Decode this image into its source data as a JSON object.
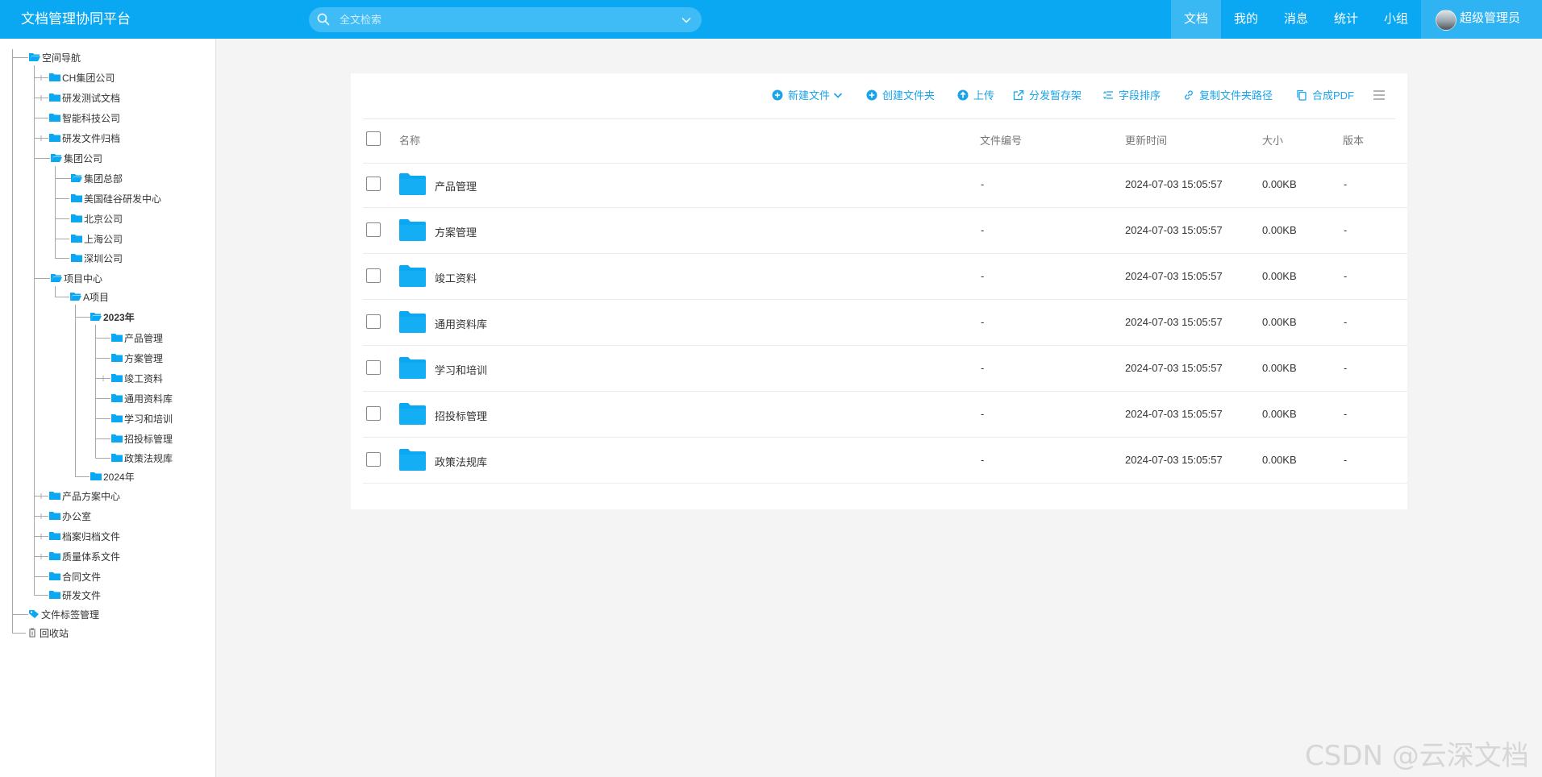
{
  "header": {
    "title": "文档管理协同平台",
    "search_placeholder": "全文检索",
    "nav": [
      "文档",
      "我的",
      "消息",
      "统计",
      "小组"
    ],
    "active_nav": "文档",
    "user_name": "超级管理员"
  },
  "sidebar": {
    "root": "空间导航",
    "items": {
      "ch_group": "CH集团公司",
      "rd_test": "研发测试文档",
      "smart_tech": "智能科技公司",
      "rd_archive": "研发文件归档",
      "group_company": "集团公司",
      "group_hq": "集团总部",
      "us_silicon": "美国硅谷研发中心",
      "beijing": "北京公司",
      "shanghai": "上海公司",
      "shenzhen": "深圳公司",
      "project_center": "项目中心",
      "project_a": "A项目",
      "year_2023": "2023年",
      "product_mgmt": "产品管理",
      "plan_mgmt": "方案管理",
      "completion": "竣工资料",
      "general_lib": "通用资料库",
      "training": "学习和培训",
      "bidding": "招投标管理",
      "policy": "政策法规库",
      "year_2024": "2024年",
      "product_solution": "产品方案中心",
      "office": "办公室",
      "archive_files": "档案归档文件",
      "quality": "质量体系文件",
      "contracts": "合同文件",
      "rd_files": "研发文件",
      "tag_mgmt": "文件标签管理",
      "recycle": "回收站"
    }
  },
  "toolbar": {
    "new_file": "新建文件",
    "create_folder": "创建文件夹",
    "upload": "上传",
    "distribute": "分发暂存架",
    "field_sort": "字段排序",
    "copy_path": "复制文件夹路径",
    "merge_pdf": "合成PDF"
  },
  "table": {
    "headers": {
      "name": "名称",
      "file_no": "文件编号",
      "updated": "更新时间",
      "size": "大小",
      "version": "版本"
    },
    "rows": [
      {
        "name": "产品管理",
        "file_no": "-",
        "updated": "2024-07-03 15:05:57",
        "size": "0.00KB",
        "version": "-"
      },
      {
        "name": "方案管理",
        "file_no": "-",
        "updated": "2024-07-03 15:05:57",
        "size": "0.00KB",
        "version": "-"
      },
      {
        "name": "竣工资料",
        "file_no": "-",
        "updated": "2024-07-03 15:05:57",
        "size": "0.00KB",
        "version": "-"
      },
      {
        "name": "通用资料库",
        "file_no": "-",
        "updated": "2024-07-03 15:05:57",
        "size": "0.00KB",
        "version": "-"
      },
      {
        "name": "学习和培训",
        "file_no": "-",
        "updated": "2024-07-03 15:05:57",
        "size": "0.00KB",
        "version": "-"
      },
      {
        "name": "招投标管理",
        "file_no": "-",
        "updated": "2024-07-03 15:05:57",
        "size": "0.00KB",
        "version": "-"
      },
      {
        "name": "政策法规库",
        "file_no": "-",
        "updated": "2024-07-03 15:05:57",
        "size": "0.00KB",
        "version": "-"
      }
    ]
  },
  "watermark": "CSDN @云深文档",
  "colors": {
    "header_bg": "#0aa8f2",
    "accent": "#1aa3e8",
    "folder": "#0aa8f2"
  }
}
